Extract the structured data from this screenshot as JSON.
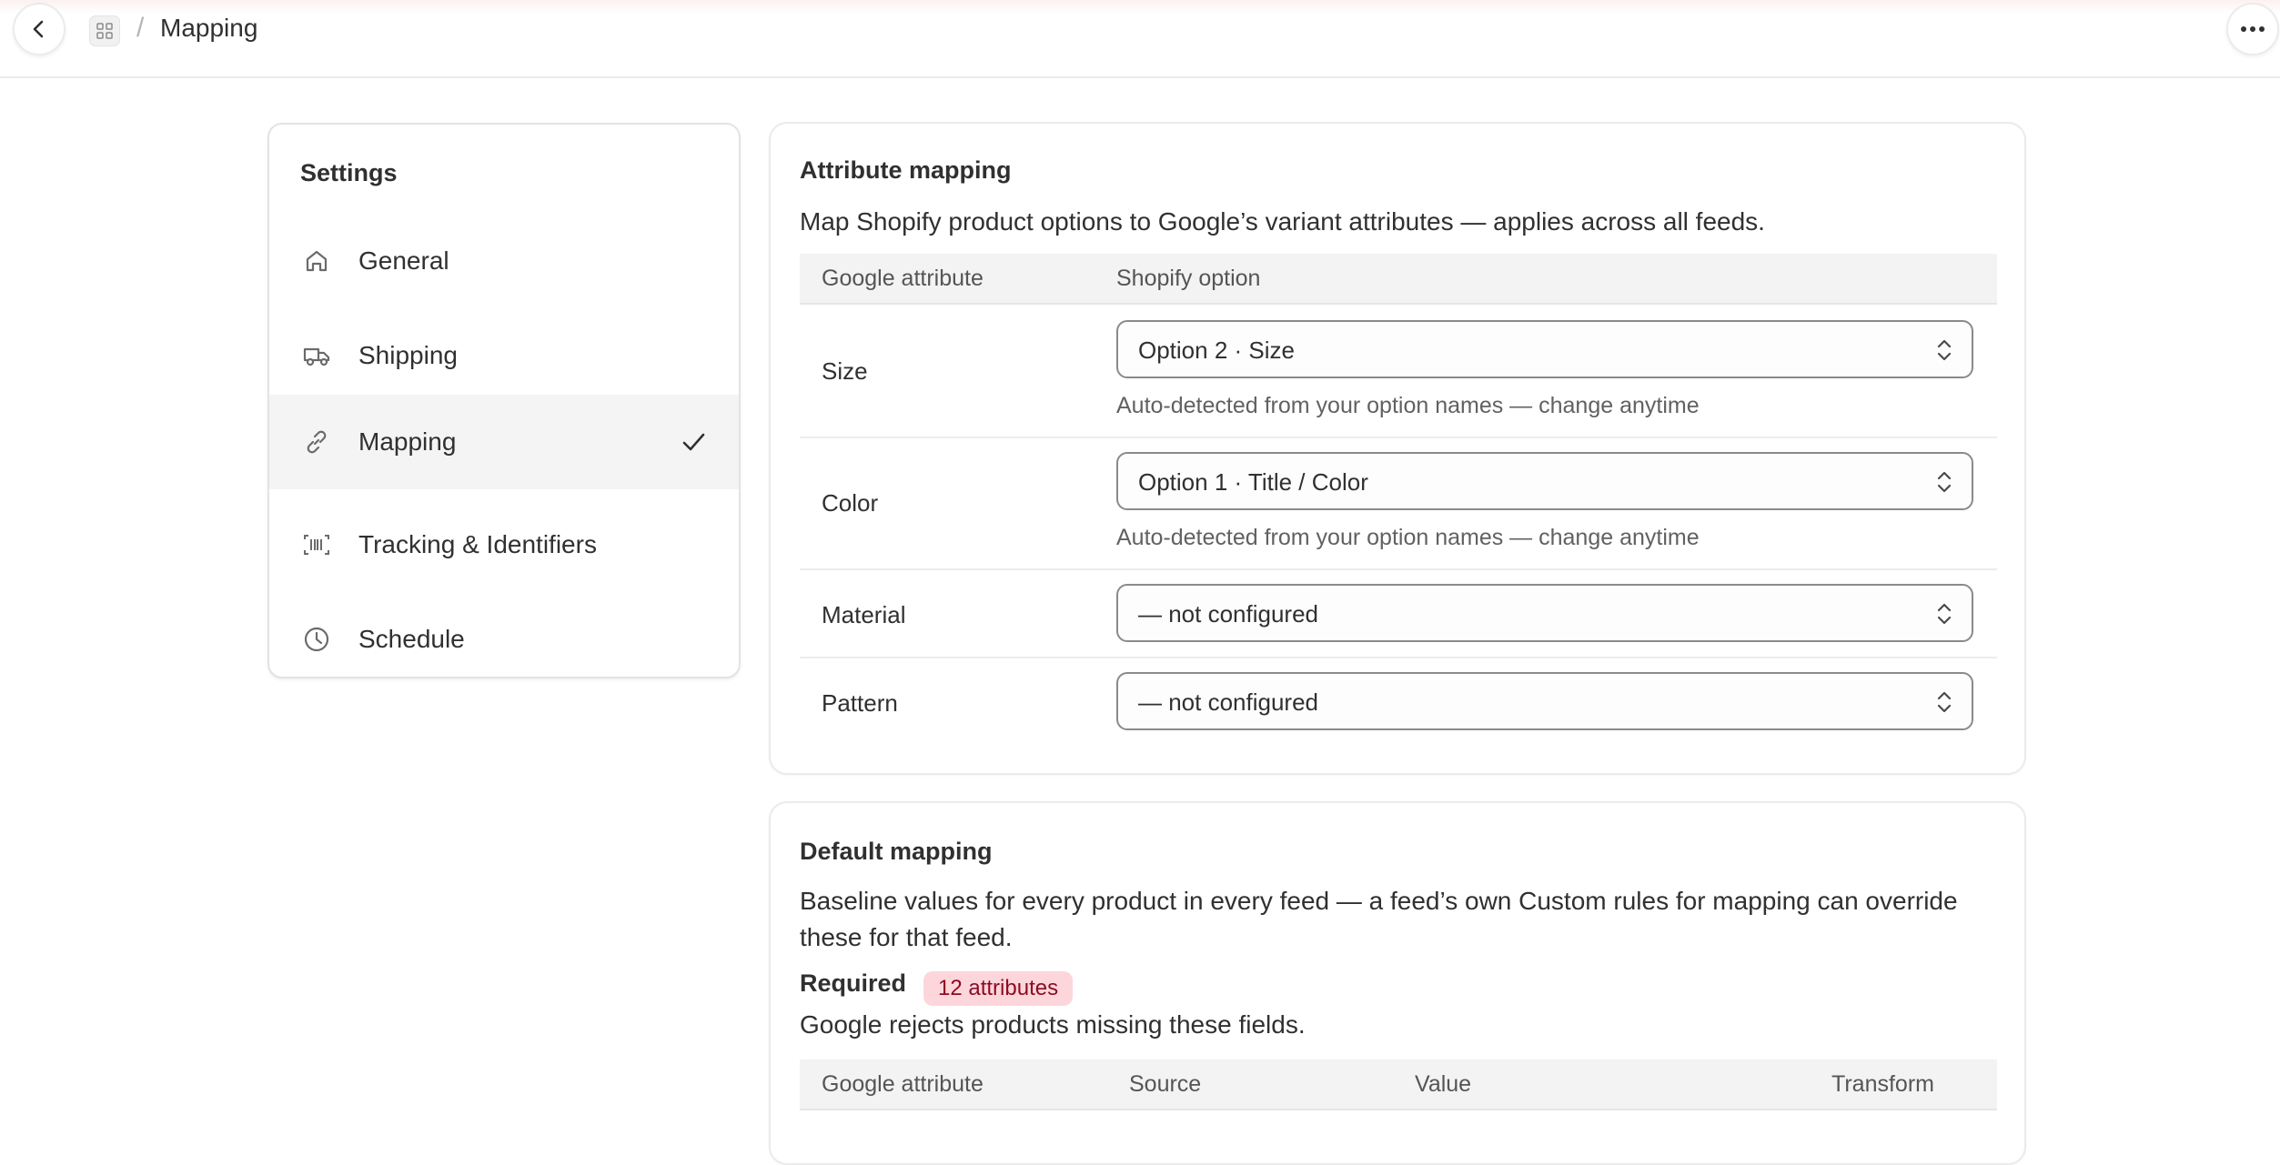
{
  "header": {
    "breadcrumb_separator": "/",
    "title": "Mapping",
    "back_icon": "chevron-left-icon",
    "app_icon": "app-grid-icon",
    "more_icon": "ellipsis-horizontal-icon"
  },
  "sidebar": {
    "heading": "Settings",
    "items": [
      {
        "label": "General",
        "icon": "home-icon",
        "active": false
      },
      {
        "label": "Shipping",
        "icon": "truck-icon",
        "active": false
      },
      {
        "label": "Mapping",
        "icon": "link-icon",
        "active": true
      },
      {
        "label": "Tracking & Identifiers",
        "icon": "barcode-icon",
        "active": false
      },
      {
        "label": "Schedule",
        "icon": "clock-icon",
        "active": false
      }
    ],
    "active_indicator_icon": "checkmark-icon"
  },
  "attribute_mapping": {
    "title": "Attribute mapping",
    "description": "Map Shopify product options to Google’s variant attributes — applies across all feeds.",
    "columns": [
      "Google attribute",
      "Shopify option"
    ],
    "rows": [
      {
        "attribute": "Size",
        "value": "Option 2 · Size",
        "help": "Auto-detected from your option names — change anytime"
      },
      {
        "attribute": "Color",
        "value": "Option 1 · Title / Color",
        "help": "Auto-detected from your option names — change anytime"
      },
      {
        "attribute": "Material",
        "value": "— not configured",
        "help": ""
      },
      {
        "attribute": "Pattern",
        "value": "— not configured",
        "help": ""
      }
    ]
  },
  "default_mapping": {
    "title": "Default mapping",
    "description_line1": "Baseline values for every product in every feed — a feed’s own Custom rules for mapping can override",
    "description_line2": "these for that feed.",
    "required_label": "Required",
    "required_badge": "12 attributes",
    "required_description": "Google rejects products missing these fields.",
    "columns": [
      "Google attribute",
      "Source",
      "Value",
      "Transform"
    ]
  },
  "colors": {
    "badge_bg": "#fdd6dc",
    "badge_text": "#8e0b21",
    "active_item_bg": "#f4f4f4"
  }
}
